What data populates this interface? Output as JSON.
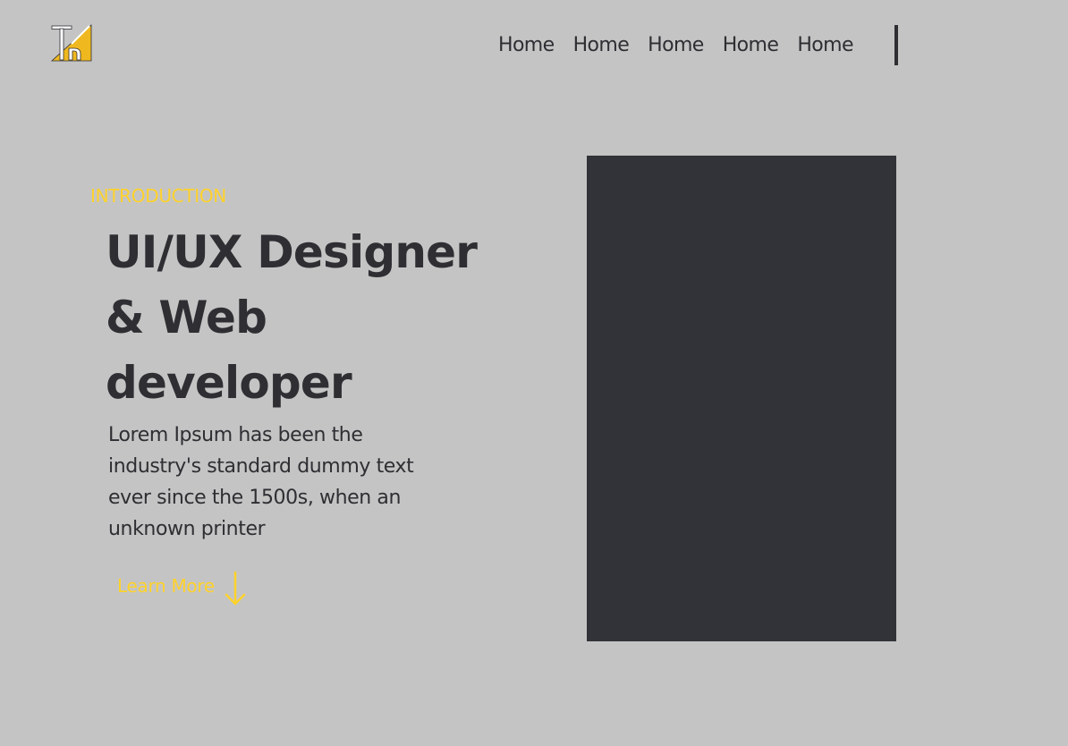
{
  "brand": {
    "logo_icon": "tk-monogram-logo",
    "accent_color": "#ffd22b"
  },
  "nav": {
    "items": [
      {
        "label": "Home"
      },
      {
        "label": "Home"
      },
      {
        "label": "Home"
      },
      {
        "label": "Home"
      },
      {
        "label": "Home"
      }
    ]
  },
  "hero": {
    "eyebrow": "INTRODUCTION",
    "title_lines": [
      "UI/UX Designer",
      "& Web",
      "developer"
    ],
    "description_lines": [
      "Lorem Ipsum has been the",
      "industry's standard dummy text",
      "ever since the 1500s, when an",
      "unknown printer"
    ],
    "cta_label": "Learn More",
    "cta_icon": "arrow-down-icon"
  },
  "colors": {
    "background": "#c4c4c4",
    "text_dark": "#2e2e33",
    "accent": "#ffd22b",
    "image_placeholder": "#323338"
  }
}
